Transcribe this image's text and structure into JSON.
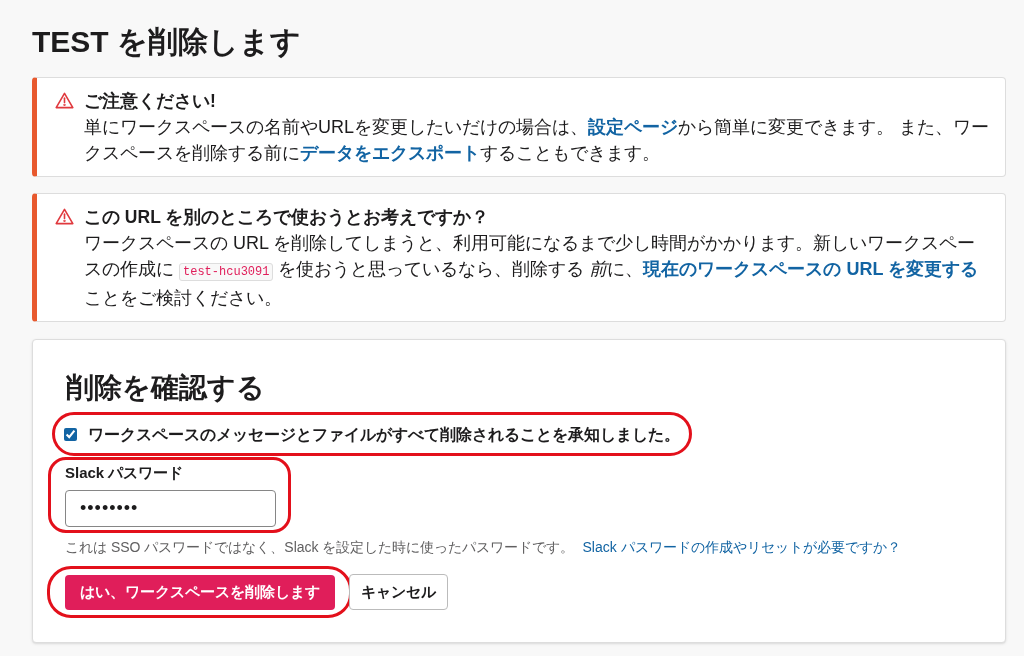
{
  "page": {
    "title": "TEST を削除します"
  },
  "notices": [
    {
      "kind": "warning",
      "title": "ご注意ください!",
      "body": [
        {
          "kind": "text",
          "text": "単にワークスペースの名前やURLを変更したいだけの場合は、"
        },
        {
          "kind": "link",
          "text": "設定ページ"
        },
        {
          "kind": "text",
          "text": "から簡単に変更できます。 また、ワークスペースを削除する前に"
        },
        {
          "kind": "link",
          "text": "データをエクスポート"
        },
        {
          "kind": "text",
          "text": "することもできます。"
        }
      ]
    },
    {
      "kind": "warning",
      "title": "この URL を別のところで使おうとお考えですか？",
      "body": [
        {
          "kind": "text",
          "text": "ワークスペースの URL を削除してしまうと、利用可能になるまで少し時間がかかります。新しいワークスペースの作成に "
        },
        {
          "kind": "code",
          "text": "test-hcu3091"
        },
        {
          "kind": "text",
          "text": " を使おうと思っているなら、削除する "
        },
        {
          "kind": "emphasis",
          "text": "前"
        },
        {
          "kind": "text",
          "text": "に、"
        },
        {
          "kind": "link",
          "text": "現在のワークスペースの URL を変更する"
        },
        {
          "kind": "text",
          "text": "ことをご検討ください。"
        }
      ]
    }
  ],
  "confirm": {
    "heading": "削除を確認する",
    "checkbox": {
      "label": "ワークスペースのメッセージとファイルがすべて削除されることを承知しました。",
      "checked": true,
      "highlighted": true
    },
    "password": {
      "label": "Slack パスワード",
      "value": "••••••••",
      "highlighted": true
    },
    "hint": [
      {
        "kind": "text",
        "text": "これは SSO パスワードではなく、Slack を設定した時に使ったパスワードです。"
      },
      {
        "kind": "link",
        "text": "Slack パスワードの作成やリセットが必要ですか？"
      }
    ],
    "buttons": [
      {
        "kind": "danger",
        "label": "はい、ワークスペースを削除します",
        "highlighted": true
      },
      {
        "kind": "secondary",
        "label": "キャンセル",
        "highlighted": false
      }
    ]
  }
}
